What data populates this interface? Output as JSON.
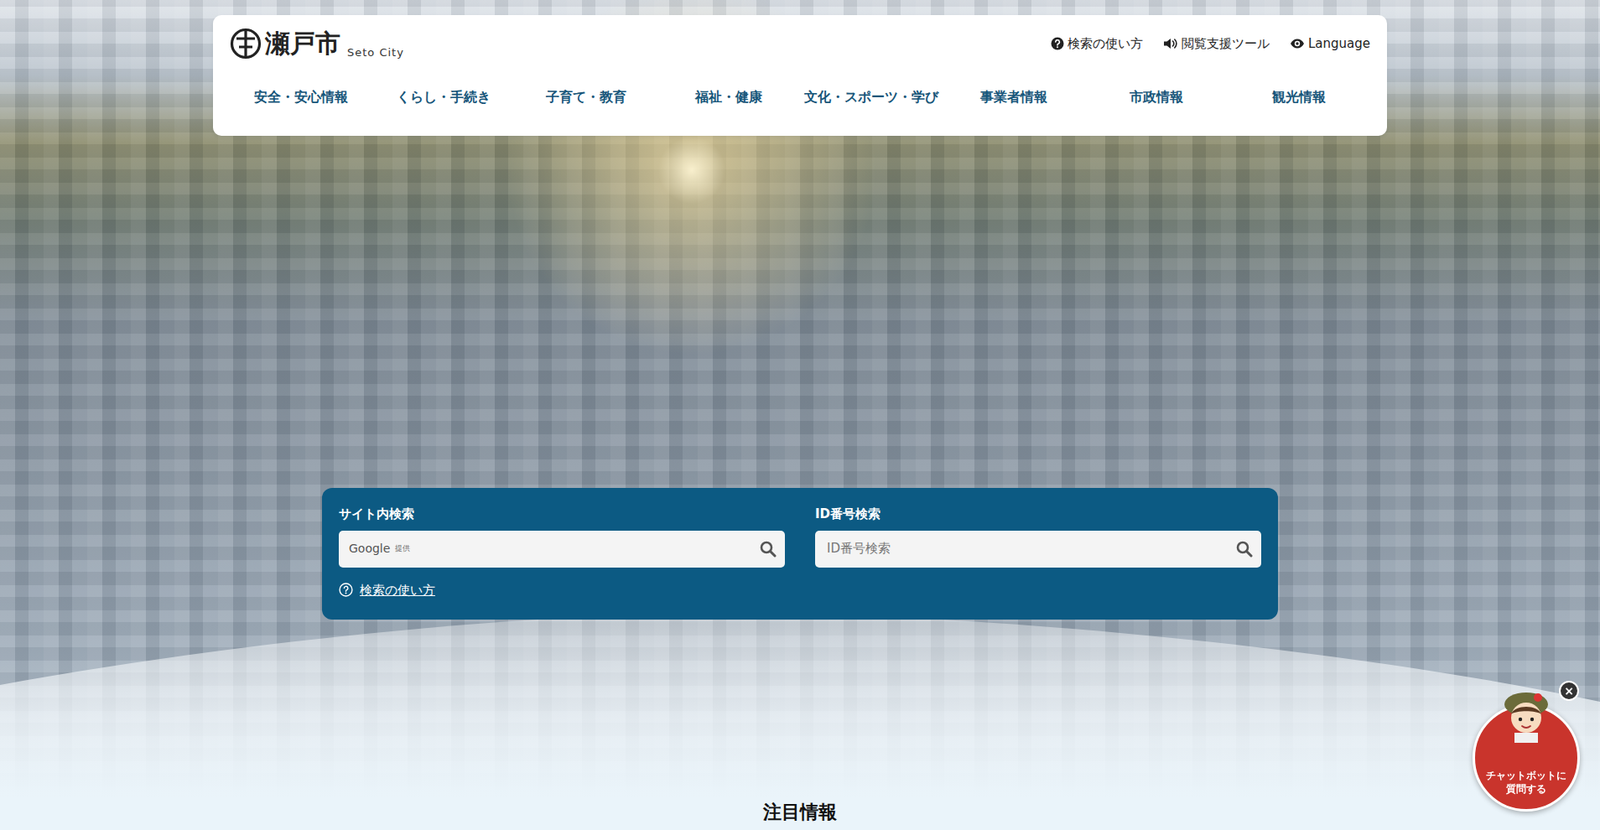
{
  "header": {
    "logo_text": "瀬戸市",
    "logo_sub": "Seto City",
    "utility_links": [
      {
        "label": "検索の使い方"
      },
      {
        "label": "閲覧支援ツール"
      },
      {
        "label": "Language"
      }
    ]
  },
  "nav": [
    {
      "label": "安全・安心情報"
    },
    {
      "label": "くらし・手続き"
    },
    {
      "label": "子育て・教育"
    },
    {
      "label": "福祉・健康"
    },
    {
      "label": "文化・スポーツ・学び"
    },
    {
      "label": "事業者情報"
    },
    {
      "label": "市政情報"
    },
    {
      "label": "観光情報"
    }
  ],
  "search": {
    "site": {
      "label": "サイト内検索",
      "brand": "Google",
      "brand_suffix": "提供"
    },
    "id": {
      "label": "ID番号検索",
      "placeholder": "ID番号検索"
    },
    "help_link": "検索の使い方"
  },
  "section_title": "注目情報",
  "chatbot": {
    "label": "チャットボットに質問する",
    "close": "×"
  }
}
